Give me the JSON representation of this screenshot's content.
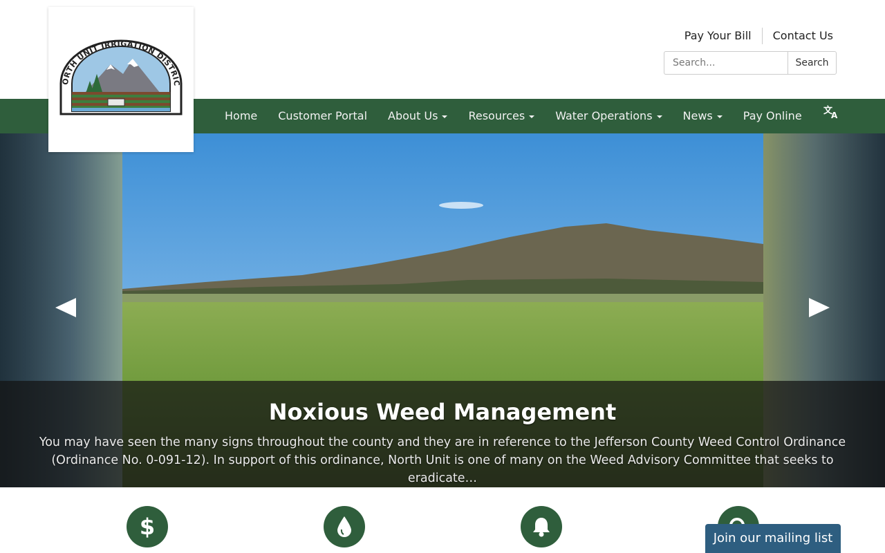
{
  "header": {
    "util_links": [
      "Pay Your Bill",
      "Contact Us"
    ],
    "search": {
      "placeholder": "Search...",
      "button_label": "Search"
    }
  },
  "logo": {
    "text": "NORTH UNIT IRRIGATION DISTRICT"
  },
  "nav": {
    "items": [
      {
        "label": "Home"
      },
      {
        "label": "Customer Portal"
      },
      {
        "label": "About Us"
      },
      {
        "label": "Resources"
      },
      {
        "label": "Water Operations"
      },
      {
        "label": "News"
      },
      {
        "label": "Pay Online"
      }
    ],
    "translate_icon": "translate-icon"
  },
  "carousel": {
    "title": "Noxious Weed Management",
    "text": "You may have seen the many signs throughout the county and they are in reference to the Jefferson County Weed Control Ordinance (Ordinance No. 0-091-12). In support of this ordinance, North Unit is one of many on the Weed Advisory Committee that seeks to eradicate…"
  },
  "features": {
    "icons": [
      "dollar-icon",
      "water-drop-icon",
      "bell-icon",
      "search-icon"
    ]
  },
  "mailing_list": {
    "label": "Join our mailing list"
  },
  "colors": {
    "brand_green": "#2f5e3c",
    "mailing_blue": "#2e5e80"
  }
}
